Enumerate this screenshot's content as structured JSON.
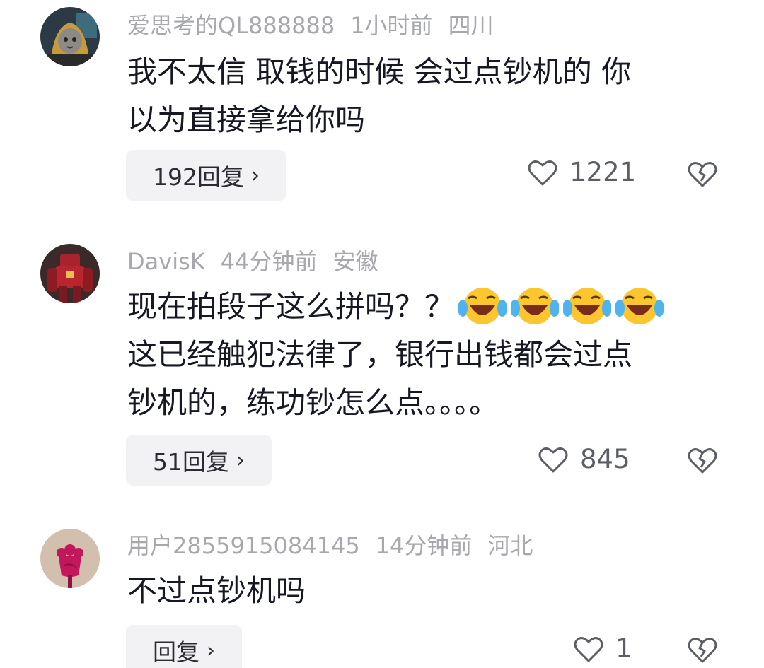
{
  "comments": [
    {
      "username": "爱思考的QL888888",
      "time": "1小时前",
      "location": "四川",
      "text_lines": [
        "我不太信 取钱的时候 会过点钞机的 你",
        "以为直接拿给你吗"
      ],
      "reply_label": "192回复",
      "likes": "1221",
      "avatar_icon": "hooded-cat-avatar"
    },
    {
      "username": "DavisK",
      "time": "44分钟前",
      "location": "安徽",
      "text_line1": "现在拍段子这么拼吗？？",
      "emojis": [
        "laughing-crying-emoji",
        "laughing-crying-emoji",
        "laughing-crying-emoji",
        "laughing-crying-emoji"
      ],
      "text_lines_rest": [
        "这已经触犯法律了，银行出钱都会过点",
        "钞机的，练功钞怎么点。。。。"
      ],
      "reply_label": "51回复",
      "likes": "845",
      "avatar_icon": "robot-armor-avatar"
    },
    {
      "username": "用户2855915084145",
      "time": "14分钟前",
      "location": "河北",
      "text_lines": [
        "不过点钞机吗"
      ],
      "reply_label": "回复",
      "likes": "1",
      "avatar_icon": "red-flower-avatar"
    }
  ],
  "icons": {
    "like": "heart-outline-icon",
    "dislike": "broken-heart-icon",
    "chevron": "chevron-right-icon"
  },
  "chevron_glyph": "›",
  "colors": {
    "meta": "#a7a8ad",
    "text": "#161823",
    "reply_bg": "#f2f2f4"
  }
}
